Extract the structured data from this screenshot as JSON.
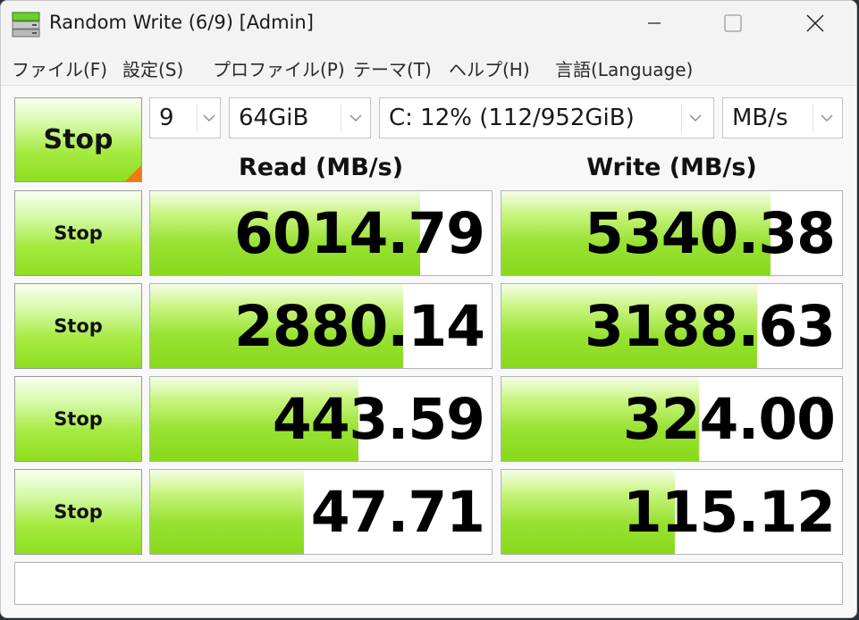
{
  "window": {
    "title": "Random Write (6/9) [Admin]"
  },
  "menu": [
    {
      "label": "ファイル(F)"
    },
    {
      "label": "設定(S)"
    },
    {
      "label": "プロファイル(P)"
    },
    {
      "label": "テーマ(T)"
    },
    {
      "label": "ヘルプ(H)"
    },
    {
      "label": "言語(Language)"
    }
  ],
  "controls": {
    "all_button": "Stop",
    "count": "9",
    "size": "64GiB",
    "drive": "C: 12% (112/952GiB)",
    "unit": "MB/s"
  },
  "headers": {
    "read": "Read (MB/s)",
    "write": "Write (MB/s)"
  },
  "rows": [
    {
      "button": "Stop",
      "read": "6014.79",
      "read_fill": 0.79,
      "write": "5340.38",
      "write_fill": 0.79
    },
    {
      "button": "Stop",
      "read": "2880.14",
      "read_fill": 0.74,
      "write": "3188.63",
      "write_fill": 0.75
    },
    {
      "button": "Stop",
      "read": "443.59",
      "read_fill": 0.61,
      "write": "324.00",
      "write_fill": 0.58
    },
    {
      "button": "Stop",
      "read": "47.71",
      "read_fill": 0.45,
      "write": "115.12",
      "write_fill": 0.51
    }
  ],
  "comment": "",
  "colors": {
    "accent_green": "#98e232",
    "corner_orange": "#ee7a11"
  },
  "icons": {
    "app": "disk-drive-icon",
    "minimize": "minimize-icon",
    "maximize": "maximize-icon",
    "close": "close-icon",
    "dropdown": "chevron-down-icon"
  }
}
